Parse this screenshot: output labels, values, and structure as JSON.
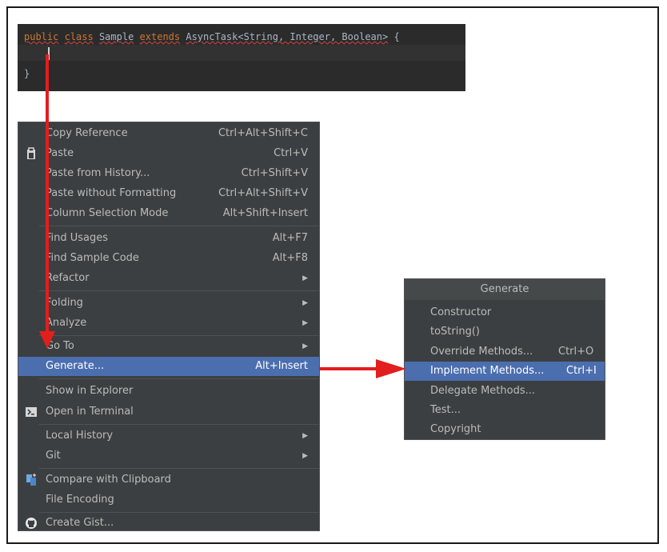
{
  "editor": {
    "line1": {
      "kw1": "public",
      "kw2": "class",
      "name": "Sample",
      "kw3": "extends",
      "type": "AsyncTask<String, Integer, Boolean>",
      "brace": "{"
    },
    "line3": "}"
  },
  "context_menu": {
    "items": [
      {
        "label": "Copy Reference",
        "shortcut": "Ctrl+Alt+Shift+C"
      },
      {
        "label": "Paste",
        "shortcut": "Ctrl+V",
        "icon": "clipboard-icon"
      },
      {
        "label": "Paste from History...",
        "shortcut": "Ctrl+Shift+V"
      },
      {
        "label": "Paste without Formatting",
        "shortcut": "Ctrl+Alt+Shift+V"
      },
      {
        "label": "Column Selection Mode",
        "shortcut": "Alt+Shift+Insert"
      },
      {
        "label": "Find Usages",
        "shortcut": "Alt+F7"
      },
      {
        "label": "Find Sample Code",
        "shortcut": "Alt+F8"
      },
      {
        "label": "Refactor",
        "submenu": true
      },
      {
        "label": "Folding",
        "submenu": true
      },
      {
        "label": "Analyze",
        "submenu": true
      },
      {
        "label": "Go To",
        "submenu": true
      },
      {
        "label": "Generate...",
        "shortcut": "Alt+Insert",
        "selected": true
      },
      {
        "label": "Show in Explorer"
      },
      {
        "label": "Open in Terminal",
        "icon": "terminal-icon"
      },
      {
        "label": "Local History",
        "submenu": true
      },
      {
        "label": "Git",
        "submenu": true
      },
      {
        "label": "Compare with Clipboard",
        "icon": "compare-icon"
      },
      {
        "label": "File Encoding"
      },
      {
        "label": "Create Gist...",
        "icon": "github-icon"
      }
    ]
  },
  "generate_popup": {
    "title": "Generate",
    "items": [
      {
        "label": "Constructor"
      },
      {
        "label": "toString()"
      },
      {
        "label": "Override Methods...",
        "shortcut": "Ctrl+O"
      },
      {
        "label": "Implement Methods...",
        "shortcut": "Ctrl+I",
        "selected": true
      },
      {
        "label": "Delegate Methods..."
      },
      {
        "label": "Test..."
      },
      {
        "label": "Copyright"
      }
    ]
  },
  "colors": {
    "menu_bg": "#3c3f41",
    "selection": "#4b6eaf",
    "arrow": "#e31e1e",
    "editor_bg": "#2b2b2b"
  }
}
